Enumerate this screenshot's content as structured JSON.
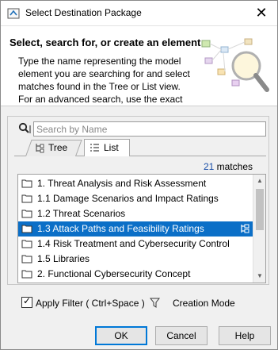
{
  "window": {
    "title": "Select Destination Package",
    "close_glyph": "✕"
  },
  "header": {
    "title": "Select, search for, or create an element",
    "description": "Type the name representing the model element you are searching for and select matches found in the Tree or List view. For an advanced search, use the exact"
  },
  "search": {
    "placeholder": "Search by Name",
    "value": ""
  },
  "tabs": [
    {
      "label": "Tree",
      "active": false
    },
    {
      "label": "List",
      "active": true
    }
  ],
  "matches": {
    "count": "21",
    "label": "matches"
  },
  "list": {
    "items": [
      {
        "label": "1. Threat Analysis and Risk Assessment",
        "selected": false
      },
      {
        "label": "1.1 Damage Scenarios and Impact Ratings",
        "selected": false
      },
      {
        "label": "1.2 Threat Scenarios",
        "selected": false
      },
      {
        "label": "1.3 Attack Paths and Feasibility Ratings",
        "selected": true
      },
      {
        "label": "1.4 Risk Treatment and Cybersecurity Control",
        "selected": false
      },
      {
        "label": "1.5 Libraries",
        "selected": false
      },
      {
        "label": "2. Functional Cybersecurity Concept",
        "selected": false
      }
    ]
  },
  "filter": {
    "apply_label": "Apply Filter ( Ctrl+Space )",
    "checked": true,
    "creation_mode_label": "Creation Mode"
  },
  "buttons": {
    "ok": "OK",
    "cancel": "Cancel",
    "help": "Help"
  },
  "colors": {
    "selection": "#0b6fc7",
    "match_count": "#1a4fa8"
  },
  "icons": [
    "app-icon",
    "close-icon",
    "search-icon",
    "tree-tab-icon",
    "list-tab-icon",
    "folder-icon",
    "tree-navigate-icon",
    "filter-icon",
    "header-illustration"
  ]
}
